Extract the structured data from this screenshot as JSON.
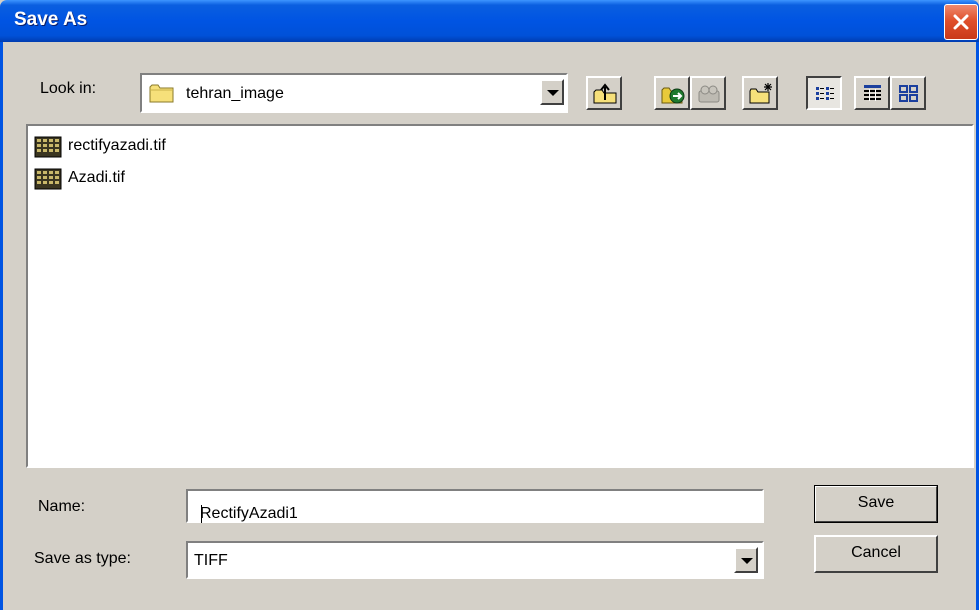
{
  "window": {
    "title": "Save As"
  },
  "look_in": {
    "label": "Look in:",
    "value": "tehran_image"
  },
  "toolbar": {
    "buttons": [
      {
        "name": "up-one-level",
        "icon": "up-folder-icon"
      },
      {
        "name": "go-to-folder",
        "icon": "go-folder-icon"
      },
      {
        "name": "map-drive",
        "icon": "drive-icon"
      },
      {
        "name": "create-new-folder",
        "icon": "new-folder-icon"
      },
      {
        "name": "list-view",
        "icon": "list-view-icon",
        "pressed": true
      },
      {
        "name": "details-view",
        "icon": "details-view-icon"
      },
      {
        "name": "thumbnails-view",
        "icon": "thumbnails-view-icon"
      }
    ]
  },
  "files": [
    {
      "name": "rectifyazadi.tif",
      "icon": "tif-image-icon"
    },
    {
      "name": "Azadi.tif",
      "icon": "tif-image-icon"
    }
  ],
  "name_field": {
    "label": "Name:",
    "value": "RectifyAzadi1"
  },
  "type_field": {
    "label": "Save as type:",
    "value": "TIFF"
  },
  "buttons": {
    "save": "Save",
    "cancel": "Cancel"
  },
  "colors": {
    "titlebar": "#0054e3",
    "dialog_bg": "#d4d0c8",
    "close": "#e0502c"
  }
}
